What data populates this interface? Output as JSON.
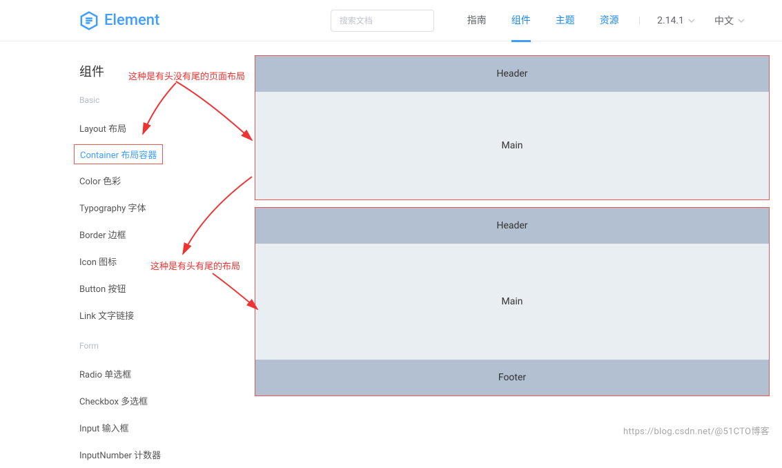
{
  "logo": {
    "text": "Element"
  },
  "search": {
    "placeholder": "搜索文档"
  },
  "nav": {
    "guide": "指南",
    "component": "组件",
    "theme": "主题",
    "resources": "资源",
    "version": "2.14.1",
    "language": "中文"
  },
  "sidebar": {
    "title": "组件",
    "group_basic": "Basic",
    "group_form": "Form",
    "items": {
      "layout": "Layout 布局",
      "container": "Container 布局容器",
      "color": "Color 色彩",
      "typography": "Typography 字体",
      "border": "Border 边框",
      "icon": "Icon 图标",
      "button": "Button 按钮",
      "link": "Link 文字链接",
      "radio": "Radio 单选框",
      "checkbox": "Checkbox 多选框",
      "input": "Input 输入框",
      "inputnumber": "InputNumber 计数器"
    }
  },
  "demo": {
    "header": "Header",
    "main": "Main",
    "footer": "Footer"
  },
  "annotations": {
    "a1": "这种是有头没有尾的页面布局",
    "a2": "这种是有头有尾的布局"
  },
  "watermark": {
    "left": "https://blog.csdn.net/",
    "right": "@51CTO博客"
  }
}
